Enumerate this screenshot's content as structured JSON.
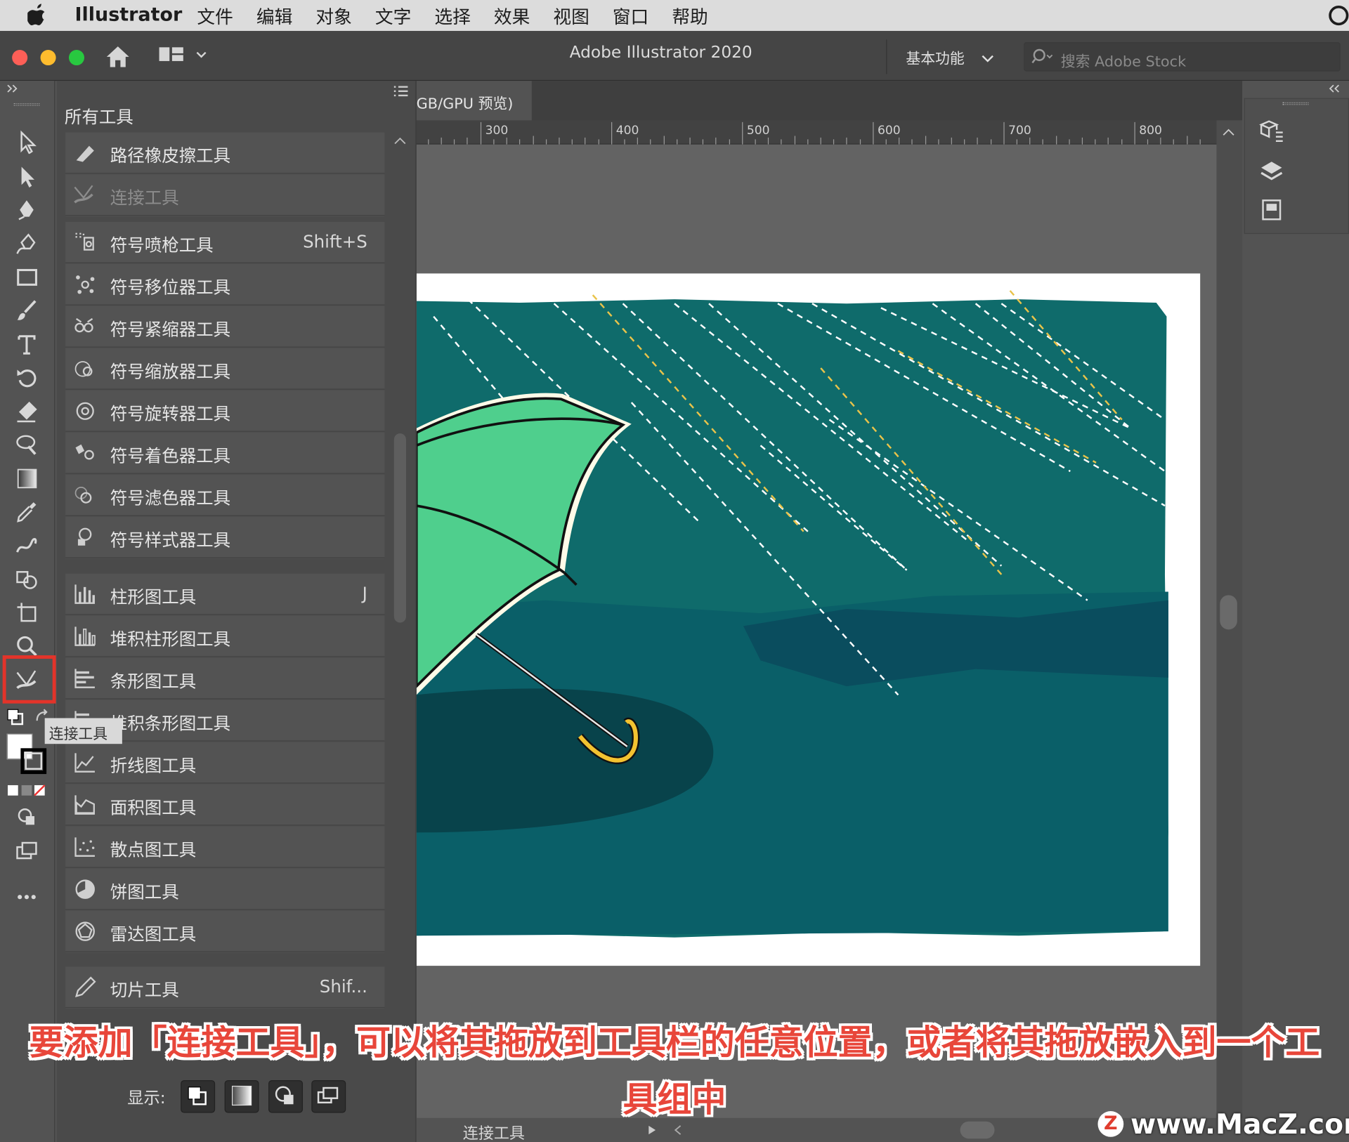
{
  "menubar": {
    "app_name": "Illustrator",
    "menus": [
      "文件",
      "编辑",
      "对象",
      "文字",
      "选择",
      "效果",
      "视图",
      "窗口",
      "帮助"
    ]
  },
  "titlebar": {
    "title": "Adobe Illustrator 2020",
    "workspace": "基本功能",
    "search_placeholder": "搜索 Adobe Stock"
  },
  "document_tab": {
    "label": "GB/GPU 预览)"
  },
  "ruler": {
    "ticks": [
      "300",
      "400",
      "500",
      "600",
      "700",
      "800"
    ]
  },
  "panel": {
    "title": "所有工具",
    "groups": [
      {
        "rows": [
          {
            "icon": "path-eraser-icon",
            "label": "路径橡皮擦工具",
            "shortcut": "",
            "dim": false
          },
          {
            "icon": "join-tool-icon",
            "label": "连接工具",
            "shortcut": "",
            "dim": true
          }
        ]
      },
      {
        "rows": [
          {
            "icon": "symbol-sprayer-icon",
            "label": "符号喷枪工具",
            "shortcut": "Shift+S",
            "dim": false
          },
          {
            "icon": "symbol-shifter-icon",
            "label": "符号移位器工具",
            "shortcut": "",
            "dim": false
          },
          {
            "icon": "symbol-scruncher-icon",
            "label": "符号紧缩器工具",
            "shortcut": "",
            "dim": false
          },
          {
            "icon": "symbol-sizer-icon",
            "label": "符号缩放器工具",
            "shortcut": "",
            "dim": false
          },
          {
            "icon": "symbol-spinner-icon",
            "label": "符号旋转器工具",
            "shortcut": "",
            "dim": false
          },
          {
            "icon": "symbol-stainer-icon",
            "label": "符号着色器工具",
            "shortcut": "",
            "dim": false
          },
          {
            "icon": "symbol-screener-icon",
            "label": "符号滤色器工具",
            "shortcut": "",
            "dim": false
          },
          {
            "icon": "symbol-styler-icon",
            "label": "符号样式器工具",
            "shortcut": "",
            "dim": false
          }
        ]
      },
      {
        "rows": [
          {
            "icon": "column-graph-icon",
            "label": "柱形图工具",
            "shortcut": "J",
            "dim": false
          },
          {
            "icon": "stacked-column-graph-icon",
            "label": "堆积柱形图工具",
            "shortcut": "",
            "dim": false
          },
          {
            "icon": "bar-graph-icon",
            "label": "条形图工具",
            "shortcut": "",
            "dim": false
          },
          {
            "icon": "stacked-bar-graph-icon",
            "label": "堆积条形图工具",
            "shortcut": "",
            "dim": false
          },
          {
            "icon": "line-graph-icon",
            "label": "折线图工具",
            "shortcut": "",
            "dim": false
          },
          {
            "icon": "area-graph-icon",
            "label": "面积图工具",
            "shortcut": "",
            "dim": false
          },
          {
            "icon": "scatter-graph-icon",
            "label": "散点图工具",
            "shortcut": "",
            "dim": false
          },
          {
            "icon": "pie-graph-icon",
            "label": "饼图工具",
            "shortcut": "",
            "dim": false
          },
          {
            "icon": "radar-graph-icon",
            "label": "雷达图工具",
            "shortcut": "",
            "dim": false
          }
        ]
      },
      {
        "rows": [
          {
            "icon": "slice-tool-icon",
            "label": "切片工具",
            "shortcut": "Shif...",
            "dim": false
          }
        ]
      }
    ],
    "display_label": "显示:"
  },
  "tooltip": {
    "text": "连接工具"
  },
  "status": {
    "tool_name": "连接工具"
  },
  "caption": {
    "line1": "要添加「连接工具」，可以将其拖放到工具栏的任意位置，或者将其拖放嵌入到一个工",
    "line2": "具组中"
  },
  "watermark": {
    "logo": "Z",
    "text": "www.MacZ.com"
  },
  "colors": {
    "highlight_box": "#e3342a",
    "caption_text": "#e8463a",
    "artwork_bg": "#0f6b6b",
    "umbrella": "#4fcf8d"
  }
}
